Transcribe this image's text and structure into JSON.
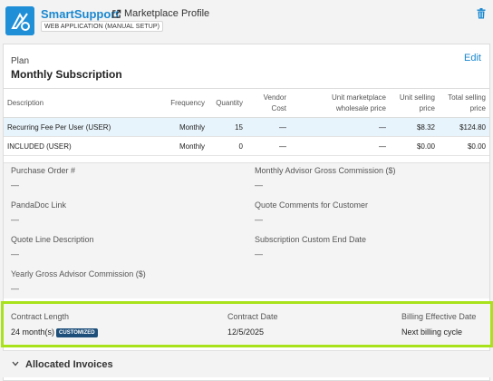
{
  "app": {
    "name": "SmartSupport",
    "marketplace_link": "Marketplace Profile",
    "subtitle": "WEB APPLICATION (MANUAL SETUP)"
  },
  "plan": {
    "label": "Plan",
    "title": "Monthly Subscription",
    "edit": "Edit"
  },
  "table": {
    "headers": {
      "description": "Description",
      "frequency": "Frequency",
      "quantity": "Quantity",
      "vendor_cost_1": "Vendor",
      "vendor_cost_2": "Cost",
      "wholesale_1": "Unit marketplace",
      "wholesale_2": "wholesale price",
      "unit_selling_1": "Unit selling",
      "unit_selling_2": "price",
      "total_selling_1": "Total selling",
      "total_selling_2": "price"
    },
    "rows": [
      {
        "description": "Recurring Fee Per User (USER)",
        "frequency": "Monthly",
        "quantity": "15",
        "vendor_cost": "—",
        "wholesale": "—",
        "unit_price": "$8.32",
        "total_price": "$124.80"
      },
      {
        "description": "INCLUDED (USER)",
        "frequency": "Monthly",
        "quantity": "0",
        "vendor_cost": "—",
        "wholesale": "—",
        "unit_price": "$0.00",
        "total_price": "$0.00"
      }
    ]
  },
  "fields": {
    "po": {
      "label": "Purchase Order #",
      "value": "—"
    },
    "mag": {
      "label": "Monthly Advisor Gross Commission ($)",
      "value": "—"
    },
    "pandadoc": {
      "label": "PandaDoc Link",
      "value": "—"
    },
    "qcc": {
      "label": "Quote Comments for Customer",
      "value": "—"
    },
    "qld": {
      "label": "Quote Line Description",
      "value": "—"
    },
    "sced": {
      "label": "Subscription Custom End Date",
      "value": "—"
    },
    "ygac": {
      "label": "Yearly Gross Advisor Commission ($)",
      "value": "—"
    }
  },
  "contract": {
    "length_label": "Contract Length",
    "length_value": "24 month(s)",
    "badge": "CUSTOMIZED",
    "date_label": "Contract Date",
    "date_value": "12/5/2025",
    "billing_label": "Billing Effective Date",
    "billing_value": "Next billing cycle"
  },
  "allocated": {
    "title": "Allocated Invoices"
  },
  "colors": {
    "accent": "#1a87cf",
    "highlight": "#a8e21b",
    "badge": "#1d4f7a"
  },
  "icons": [
    "app-logo-icon",
    "external-link-icon",
    "trash-icon",
    "chevron-down-icon"
  ]
}
